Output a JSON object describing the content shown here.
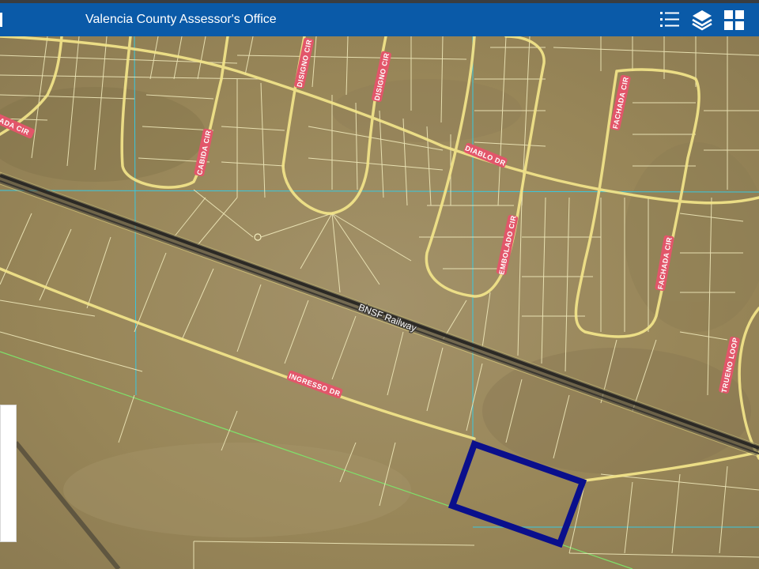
{
  "header": {
    "title": "Valencia County Assessor's Office",
    "background": "#0a5aa8",
    "buttons": [
      {
        "icon": "legend-list-icon"
      },
      {
        "icon": "layers-icon"
      },
      {
        "icon": "basemap-grid-icon"
      }
    ]
  },
  "map": {
    "roads": {
      "dada": "ADA CIR",
      "cabida": "CABIDA CIR",
      "disigno1": "DISIGNO CIR",
      "disigno2": "DISIGNO CIR",
      "diablo": "DIABLO DR",
      "fachada1": "FACHADA CIR",
      "fachada2": "FACHADA CIR",
      "embolado": "EMBOLADO CIR",
      "trueno": "TRUENO LOOP",
      "ingresso": "INGRESSO DR"
    },
    "railway": "BNSF Railway",
    "colors": {
      "imagery": "#9c8a62",
      "parcel_lines": "#f5efc0",
      "road_casing": "#f3e58a",
      "grid_lines": "#38c8e0",
      "boundary_line": "#7fe06a",
      "selected_parcel": "#0a0f8c",
      "road_label": "#e2566a"
    }
  }
}
